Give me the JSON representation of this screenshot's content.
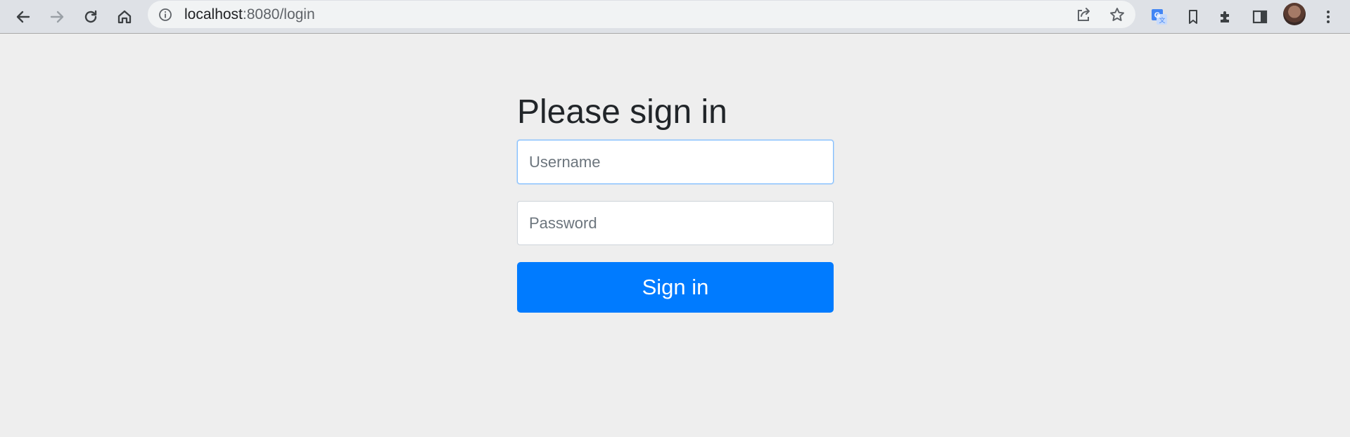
{
  "browser": {
    "url_host": "localhost",
    "url_rest": ":8080/login",
    "icons": {
      "back": "arrow-left-icon",
      "forward": "arrow-right-icon",
      "reload": "reload-icon",
      "home": "home-icon",
      "site_info": "info-icon",
      "share": "share-icon",
      "bookmark_star": "star-icon",
      "translate": "google-translate-icon",
      "reading_list": "bookmark-icon",
      "extensions": "puzzle-icon",
      "side_panel": "side-panel-icon",
      "profile": "avatar",
      "menu": "kebab-menu-icon"
    },
    "colors": {
      "toolbar_bg": "#dee1e6",
      "omnibox_bg": "#f1f3f4",
      "translate_blue": "#4285f4"
    }
  },
  "login": {
    "heading": "Please sign in",
    "username_placeholder": "Username",
    "password_placeholder": "Password",
    "submit_label": "Sign in",
    "colors": {
      "page_bg": "#eeeeee",
      "primary": "#007bff",
      "focus_border": "#80bdff"
    }
  }
}
